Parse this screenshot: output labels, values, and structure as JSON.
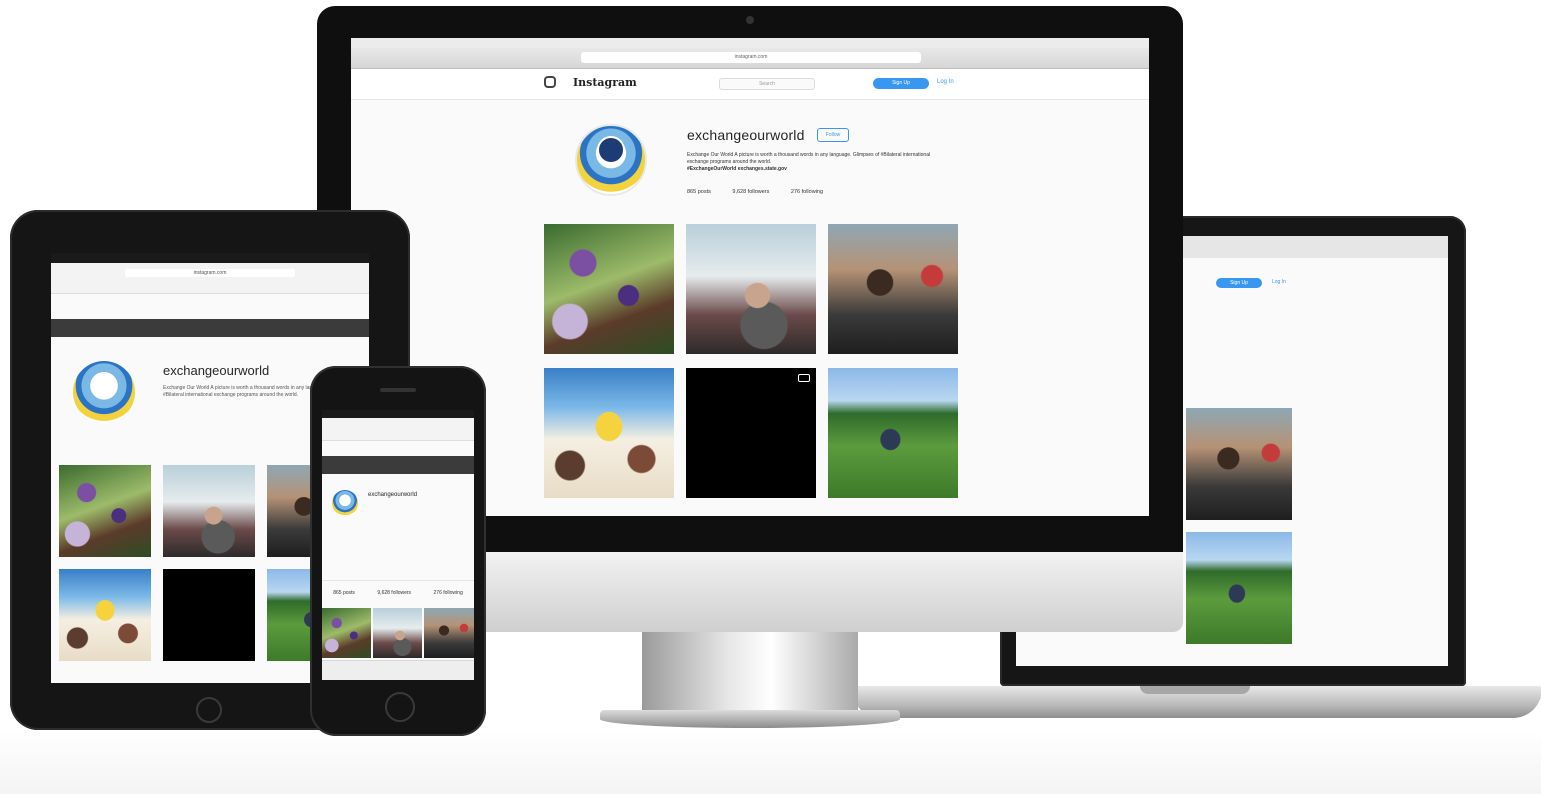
{
  "desktop": {
    "url": "instagram.com",
    "brand": "Instagram",
    "search_placeholder": "Search",
    "signup_label": "Sign Up",
    "login_label": "Log In",
    "profile": {
      "username": "exchangeourworld",
      "follow_label": "Follow",
      "bio": "Exchange Our World A picture is worth a thousand words in any language. Glimpses of #Bilateral international exchange programs around the world.",
      "link_line": "#ExchangeOurWorld exchanges.state.gov",
      "posts": "865 posts",
      "followers": "9,628 followers",
      "following": "276 following"
    }
  },
  "tablet": {
    "url": "instagram.com",
    "username": "exchangeourworld",
    "bio": "Exchange Our World A picture is worth a thousand words in any language. Glimpses of #Bilateral international exchange programs around the world."
  },
  "phone": {
    "username": "exchangeourworld",
    "stats": [
      "865 posts",
      "9,628 followers",
      "276 following"
    ]
  },
  "laptop": {
    "signup_label": "Sign Up",
    "login_label": "Log In"
  }
}
